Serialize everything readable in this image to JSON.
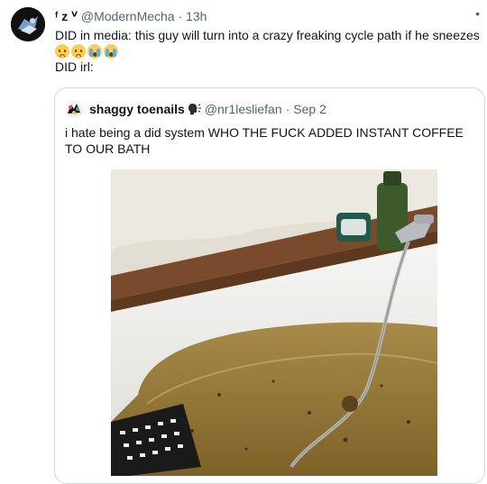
{
  "tweet": {
    "display_name": "ᶠ z ⱽ",
    "handle": "@ModernMecha",
    "separator": "·",
    "time": "13h",
    "line1": "DID in media: this guy will turn into a crazy freaking cycle path if he sneezes",
    "line3": "DID irl:",
    "emojis": [
      "frowning-face",
      "frowning-face",
      "loudly-crying-face",
      "loudly-crying-face"
    ],
    "more_icon": "more-icon"
  },
  "quote": {
    "display_name": "shaggy toenails",
    "speaking_icon": "speaking-head-icon",
    "handle": "@nr1lesliefan",
    "separator": "·",
    "date": "Sep 2",
    "text": "i hate being a did system WHO THE FUCK ADDED INSTANT COFFEE TO OUR BATH",
    "photo": "bathtub-photo"
  },
  "colors": {
    "text": "#0f1419",
    "muted": "#536471",
    "border": "#cfd9de",
    "water": "#9a7a3a"
  }
}
